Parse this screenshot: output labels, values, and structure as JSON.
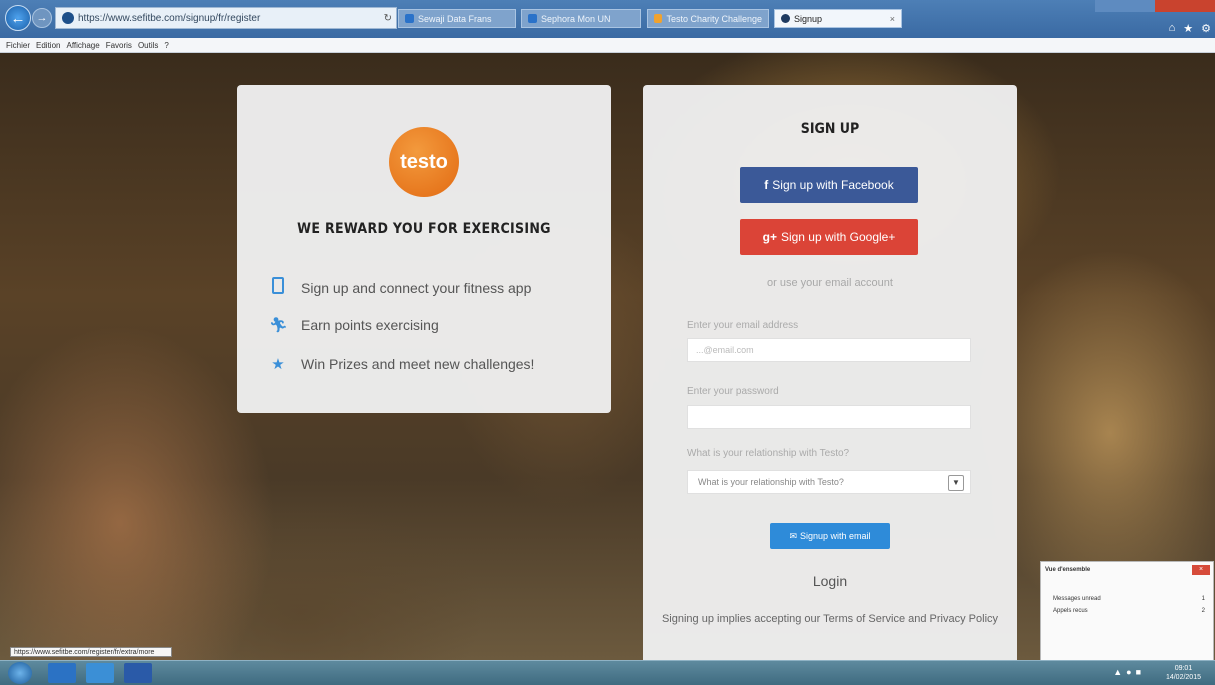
{
  "browser": {
    "url": "https://www.sefitbe.com/signup/fr/register",
    "tabs": [
      {
        "label": "Sewaji Data Frans"
      },
      {
        "label": "Sephora Mon UN"
      },
      {
        "label": "Testo Charity Challenge"
      },
      {
        "label": "Signup"
      }
    ],
    "menu": [
      "Fichier",
      "Edition",
      "Affichage",
      "Favoris",
      "Outils",
      "?"
    ],
    "status_url": "https://www.sefitbe.com/register/fr/extra/more"
  },
  "left_card": {
    "logo_text": "testo",
    "tagline": "WE REWARD YOU FOR EXERCISING",
    "features": [
      {
        "icon": "phone-icon",
        "text": "Sign up and connect your fitness app"
      },
      {
        "icon": "runner-icon",
        "text": "Earn points exercising"
      },
      {
        "icon": "star-icon",
        "text": "Win Prizes and meet new challenges!"
      }
    ]
  },
  "signup": {
    "title": "SIGN UP",
    "facebook_label": "Sign up with Facebook",
    "google_label": "Sign up with Google+",
    "or_text": "or use your email account",
    "email_label": "Enter your email address",
    "email_placeholder": "...@email.com",
    "password_label": "Enter your password",
    "relationship_label": "What is your relationship with Testo?",
    "relationship_selected": "What is your relationship with Testo?",
    "email_button": "Signup with email",
    "login_link": "Login",
    "terms_text": "Signing up implies accepting our Terms of Service and Privacy Policy"
  },
  "notification": {
    "title": "Vue d'ensemble",
    "rows": [
      {
        "label": "Messages unread",
        "count": "1"
      },
      {
        "label": "Appels recus",
        "count": "2"
      }
    ]
  },
  "taskbar": {
    "time": "09:01",
    "date": "14/02/2015"
  },
  "colors": {
    "facebook": "#3b5998",
    "google": "#db4437",
    "email_button": "#2e8bd9",
    "accent_icons": "#3a8fd8",
    "logo": "#e8741a"
  }
}
